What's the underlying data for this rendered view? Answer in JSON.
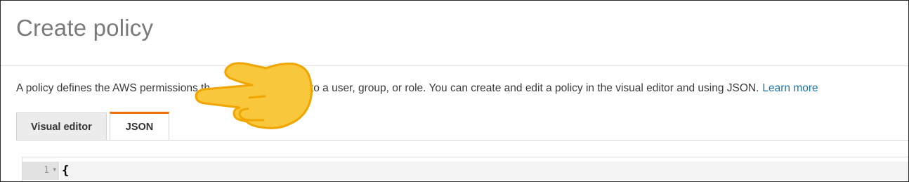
{
  "page": {
    "title": "Create policy",
    "description": "A policy defines the AWS permissions th",
    "description_rest": "n to a user, group, or role. You can create and edit a policy in the visual editor and using JSON.",
    "learn_more": "Learn more"
  },
  "tabs": [
    {
      "label": "Visual editor",
      "active": false
    },
    {
      "label": "JSON",
      "active": true
    }
  ],
  "editor": {
    "line_number": "1",
    "first_line": "{"
  },
  "colors": {
    "accent_tab": "#ec7211",
    "link": "#1a73a8",
    "pointer_fill": "#f9c73b"
  },
  "overlay": {
    "icon": "pointing-hand-icon"
  }
}
